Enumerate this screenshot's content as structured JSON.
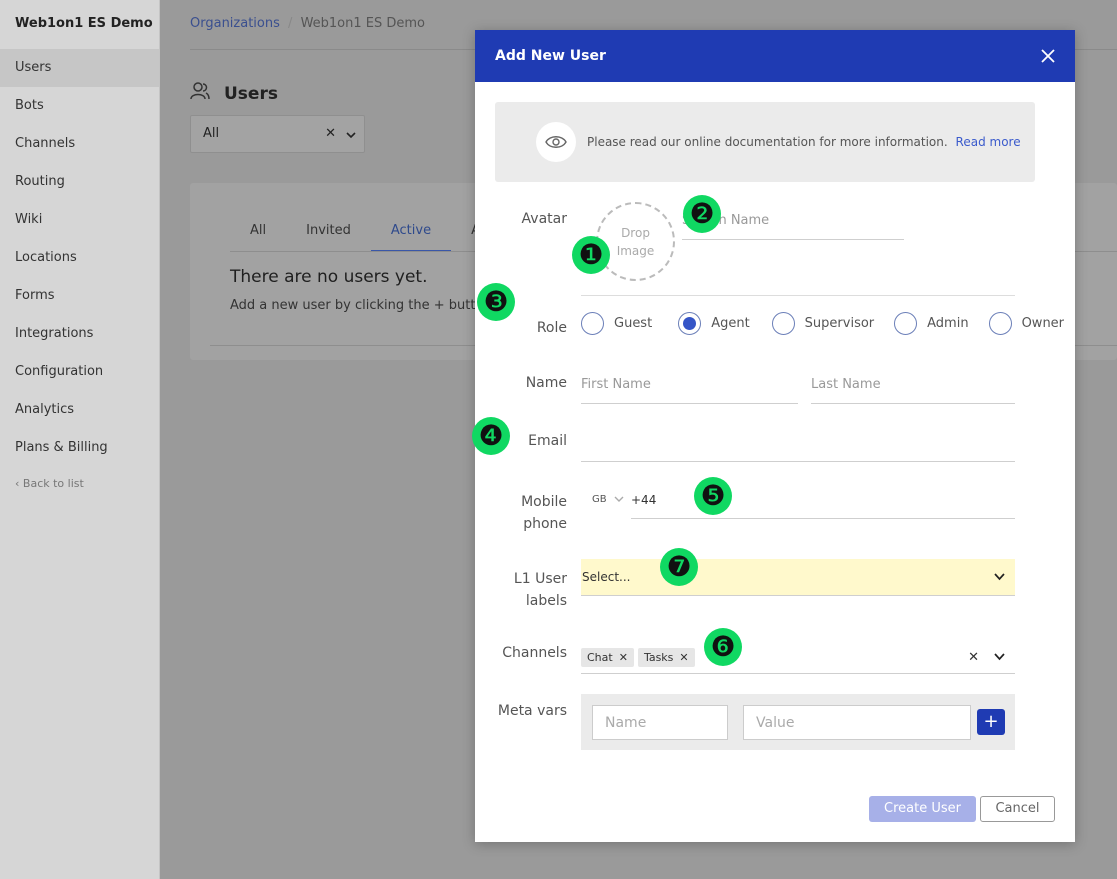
{
  "sidebar": {
    "org_name": "Web1on1 ES Demo",
    "items": [
      {
        "label": "Users",
        "active": true
      },
      {
        "label": "Bots"
      },
      {
        "label": "Channels"
      },
      {
        "label": "Routing"
      },
      {
        "label": "Wiki"
      },
      {
        "label": "Locations"
      },
      {
        "label": "Forms"
      },
      {
        "label": "Integrations"
      },
      {
        "label": "Configuration"
      },
      {
        "label": "Analytics"
      },
      {
        "label": "Plans & Billing"
      }
    ],
    "back_label": "Back to list"
  },
  "breadcrumb": {
    "root": "Organizations",
    "separator": "/",
    "current": "Web1on1 ES Demo"
  },
  "page": {
    "title": "Users",
    "filter_value": "All",
    "tabs": [
      "All",
      "Invited",
      "Active",
      "A"
    ],
    "active_tab": "Active",
    "empty_title": "There are no users yet.",
    "empty_text": "Add a new user by clicking the + button at th"
  },
  "modal": {
    "title": "Add New User",
    "notice_text": "Please read our online documentation for more information.",
    "notice_link": "Read more",
    "avatar_label": "Avatar",
    "avatar_drop_line1": "Drop",
    "avatar_drop_line2": "Image",
    "screen_name_placeholder": "Screen Name",
    "role_label": "Role",
    "roles": [
      {
        "label": "Guest",
        "checked": false
      },
      {
        "label": "Agent",
        "checked": true
      },
      {
        "label": "Supervisor",
        "checked": false
      },
      {
        "label": "Admin",
        "checked": false
      },
      {
        "label": "Owner",
        "checked": false
      }
    ],
    "name_label": "Name",
    "first_name_placeholder": "First Name",
    "last_name_placeholder": "Last Name",
    "email_label": "Email",
    "email_value": "",
    "mobile_label_line1": "Mobile",
    "mobile_label_line2": "phone",
    "country_code": "GB",
    "phone_prefix": "+44",
    "labels_label_line1": "L1 User",
    "labels_label_line2": "labels",
    "labels_placeholder": "Select...",
    "channels_label": "Channels",
    "channels": [
      "Chat",
      "Tasks"
    ],
    "meta_label": "Meta vars",
    "meta_name_placeholder": "Name",
    "meta_value_placeholder": "Value",
    "create_button": "Create User",
    "cancel_button": "Cancel"
  },
  "markers": [
    "❶",
    "❷",
    "❸",
    "❹",
    "❺",
    "❻",
    "❼"
  ],
  "colors": {
    "accent": "#1f3bb3",
    "highlight": "#fff9cc",
    "marker": "#10d862"
  }
}
